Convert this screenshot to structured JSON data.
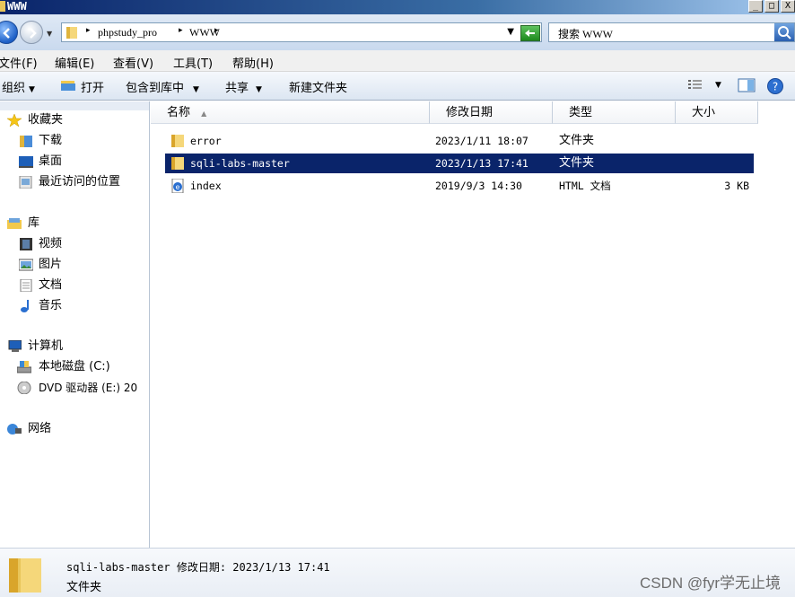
{
  "window": {
    "title": "WWW",
    "buttons": [
      "_",
      "□",
      "X"
    ]
  },
  "address": {
    "crumbs": [
      "phpstudy_pro",
      "WWW"
    ],
    "search_placeholder": "搜索 WWW"
  },
  "menu": [
    "文件(F)",
    "编辑(E)",
    "查看(V)",
    "工具(T)",
    "帮助(H)"
  ],
  "toolbar": {
    "organize": "组织",
    "open": "打开",
    "include_library": "包含到库中",
    "share": "共享",
    "new_folder": "新建文件夹"
  },
  "nav": {
    "favorites": "收藏夹",
    "downloads": "下载",
    "desktop": "桌面",
    "recent": "最近访问的位置",
    "libraries": "库",
    "videos": "视频",
    "pictures": "图片",
    "documents": "文档",
    "music": "音乐",
    "computer": "计算机",
    "local_disk": "本地磁盘 (C:)",
    "dvd": "DVD 驱动器 (E:) 20",
    "network": "网络"
  },
  "columns": [
    "名称",
    "修改日期",
    "类型",
    "大小"
  ],
  "files": [
    {
      "name": "error",
      "date": "2023/1/11 18:07",
      "type": "文件夹",
      "size": "",
      "icon": "folder-icon",
      "selected": false
    },
    {
      "name": "sqli-labs-master",
      "date": "2023/1/13 17:41",
      "type": "文件夹",
      "size": "",
      "icon": "folder-icon",
      "selected": true
    },
    {
      "name": "index",
      "date": "2019/9/3 14:30",
      "type": "HTML 文档",
      "size": "3 KB",
      "icon": "html-file-icon",
      "selected": false
    }
  ],
  "details": {
    "name_line": "sqli-labs-master 修改日期: 2023/1/13 17:41",
    "type": "文件夹"
  },
  "watermark": "CSDN @fyr学无止境",
  "colors": {
    "selection": "#0a246a",
    "titlebar": "#0a246a"
  }
}
